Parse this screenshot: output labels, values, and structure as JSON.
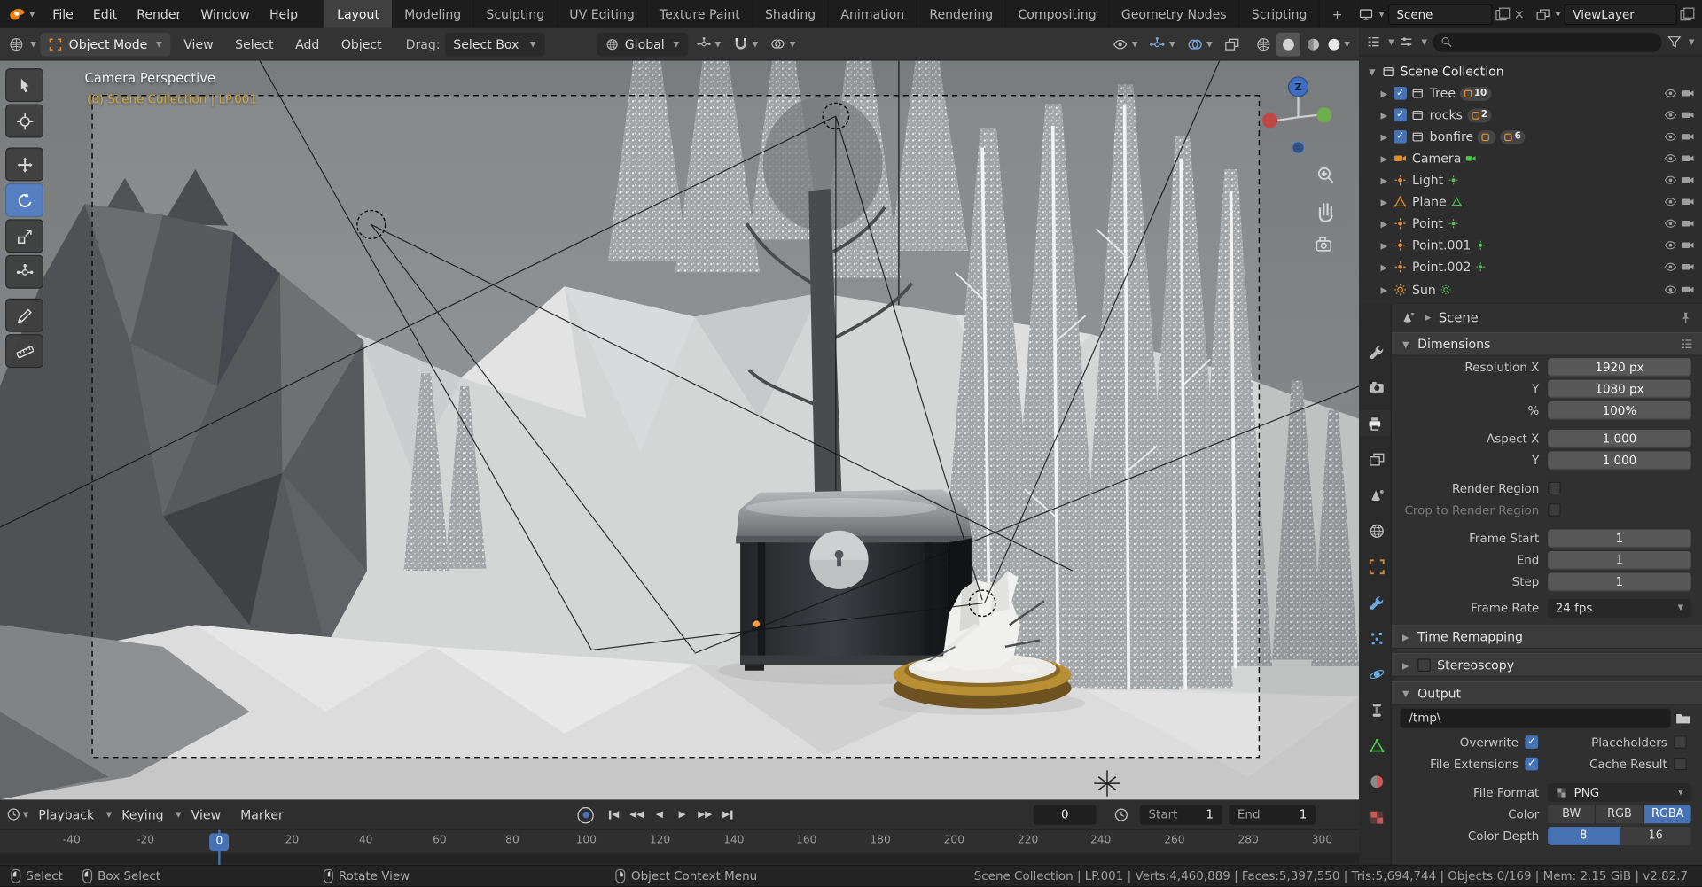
{
  "colors": {
    "accent": "#4772b3",
    "object_orange": "#e08e2d",
    "data_green": "#55c055",
    "context_yellow": "#cda53e"
  },
  "topbar": {
    "menus": [
      "File",
      "Edit",
      "Render",
      "Window",
      "Help"
    ],
    "tabs": [
      "Layout",
      "Modeling",
      "Sculpting",
      "UV Editing",
      "Texture Paint",
      "Shading",
      "Animation",
      "Rendering",
      "Compositing",
      "Geometry Nodes",
      "Scripting"
    ],
    "add_tab": "+",
    "scene_value": "Scene",
    "viewlayer_value": "ViewLayer"
  },
  "tool_header": {
    "mode": "Object Mode",
    "menus": [
      "View",
      "Select",
      "Add",
      "Object"
    ],
    "drag_label": "Drag:",
    "drag_value": "Select Box",
    "orientation_value": "Global"
  },
  "viewport": {
    "view_label": "Camera Perspective",
    "context_label": "(0) Scene Collection | LP.001",
    "axis_z": "Z"
  },
  "outliner": {
    "root_label": "Scene Collection",
    "items": [
      {
        "label": "Tree",
        "badges": [
          "10"
        ]
      },
      {
        "label": "rocks",
        "badges": [
          "2"
        ]
      },
      {
        "label": "bonfire",
        "badges": [
          "",
          "6"
        ]
      },
      {
        "label": "Camera"
      },
      {
        "label": "Light"
      },
      {
        "label": "Plane"
      },
      {
        "label": "Point"
      },
      {
        "label": "Point.001"
      },
      {
        "label": "Point.002"
      },
      {
        "label": "Sun"
      }
    ]
  },
  "properties": {
    "breadcrumb": "Scene",
    "dimensions": {
      "title": "Dimensions",
      "resolution_x_label": "Resolution X",
      "resolution_x": "1920 px",
      "resolution_y_label": "Y",
      "resolution_y": "1080 px",
      "percent_label": "%",
      "percent": "100%",
      "aspect_x_label": "Aspect X",
      "aspect_x": "1.000",
      "aspect_y_label": "Y",
      "aspect_y": "1.000",
      "render_region_label": "Render Region",
      "crop_label": "Crop to Render Region",
      "frame_start_label": "Frame Start",
      "frame_start": "1",
      "frame_end_label": "End",
      "frame_end": "1",
      "step_label": "Step",
      "step": "1",
      "frame_rate_label": "Frame Rate",
      "frame_rate": "24 fps"
    },
    "time_remapping_title": "Time Remapping",
    "stereoscopy_title": "Stereoscopy",
    "output": {
      "title": "Output",
      "path": "/tmp\\",
      "overwrite_label": "Overwrite",
      "placeholders_label": "Placeholders",
      "file_extensions_label": "File Extensions",
      "cache_result_label": "Cache Result",
      "file_format_label": "File Format",
      "file_format": "PNG",
      "color_label": "Color",
      "color_options": [
        "BW",
        "RGB",
        "RGBA"
      ],
      "color_depth_label": "Color Depth",
      "depth_options": [
        "8",
        "16"
      ]
    }
  },
  "timeline": {
    "menus": [
      "Playback",
      "Keying",
      "View",
      "Marker"
    ],
    "current_frame": "0",
    "start_label": "Start",
    "start_value": "1",
    "end_label": "End",
    "end_value": "1",
    "frame_badge": "0",
    "ruler": [
      "-40",
      "-20",
      "0",
      "20",
      "40",
      "60",
      "80",
      "100",
      "120",
      "140",
      "160",
      "180",
      "200",
      "220",
      "240",
      "260",
      "280",
      "300"
    ]
  },
  "statusbar": {
    "hints": [
      "Select",
      "Box Select",
      "Rotate View",
      "Object Context Menu"
    ],
    "info": "Scene Collection | LP.001 | Verts:4,460,889 | Faces:5,397,550 | Tris:5,694,744 | Objects:0/169 | Mem: 2.15 GiB | v2.82.7"
  }
}
